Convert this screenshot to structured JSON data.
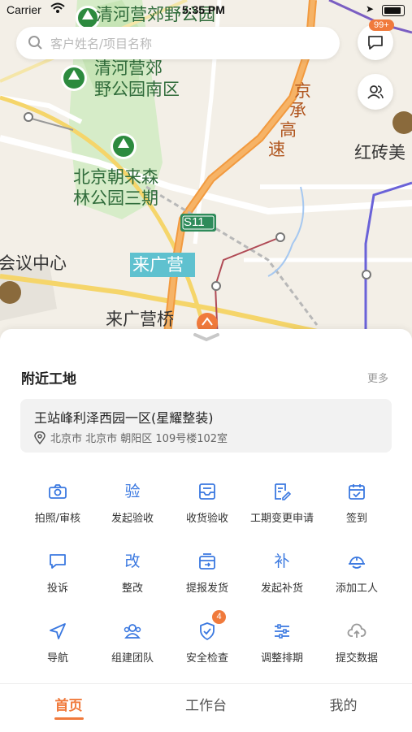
{
  "status_bar": {
    "carrier": "Carrier",
    "time": "5:35 PM"
  },
  "search": {
    "placeholder": "客户姓名/项目名称"
  },
  "messages_badge": "99+",
  "map": {
    "labels": {
      "park_top": "清河营郊野公园",
      "park_south_1": "清河营郊",
      "park_south_2": "野公园南区",
      "forest_1": "北京朝来森",
      "forest_2": "林公园三期",
      "highway_1": "京",
      "highway_2": "承",
      "highway_3": "高",
      "highway_4": "速",
      "red_brick": "红砖美",
      "s11": "S11",
      "conference": "会议中心",
      "laiguangying": "来广营",
      "laiguangying_bridge": "来广营桥"
    }
  },
  "nearby": {
    "title": "附近工地",
    "more": "更多",
    "site": {
      "name": "王站峰利泽西园一区(星耀整装)",
      "address": "北京市 北京市 朝阳区 109号楼102室"
    }
  },
  "actions": [
    {
      "label": "拍照/审核",
      "icon": "camera-icon"
    },
    {
      "label": "发起验收",
      "icon": "inspect-glyph-icon",
      "glyph": "验"
    },
    {
      "label": "收货验收",
      "icon": "inbox-icon"
    },
    {
      "label": "工期变更申请",
      "icon": "edit-document-icon"
    },
    {
      "label": "签到",
      "icon": "calendar-check-icon"
    },
    {
      "label": "投诉",
      "icon": "chat-bubble-icon"
    },
    {
      "label": "整改",
      "icon": "rectify-glyph-icon",
      "glyph": "改"
    },
    {
      "label": "提报发货",
      "icon": "ship-box-icon"
    },
    {
      "label": "发起补货",
      "icon": "restock-glyph-icon",
      "glyph": "补"
    },
    {
      "label": "添加工人",
      "icon": "hard-hat-icon"
    },
    {
      "label": "导航",
      "icon": "navigation-arrow-icon"
    },
    {
      "label": "组建团队",
      "icon": "team-icon"
    },
    {
      "label": "安全检查",
      "icon": "shield-check-icon",
      "badge": "4"
    },
    {
      "label": "调整排期",
      "icon": "sliders-icon"
    },
    {
      "label": "提交数据",
      "icon": "cloud-upload-icon"
    }
  ],
  "tabs": [
    {
      "label": "首页",
      "active": true
    },
    {
      "label": "工作台",
      "active": false
    },
    {
      "label": "我的",
      "active": false
    }
  ],
  "colors": {
    "accent": "#f07a3c",
    "icon_blue": "#3a78e0"
  }
}
